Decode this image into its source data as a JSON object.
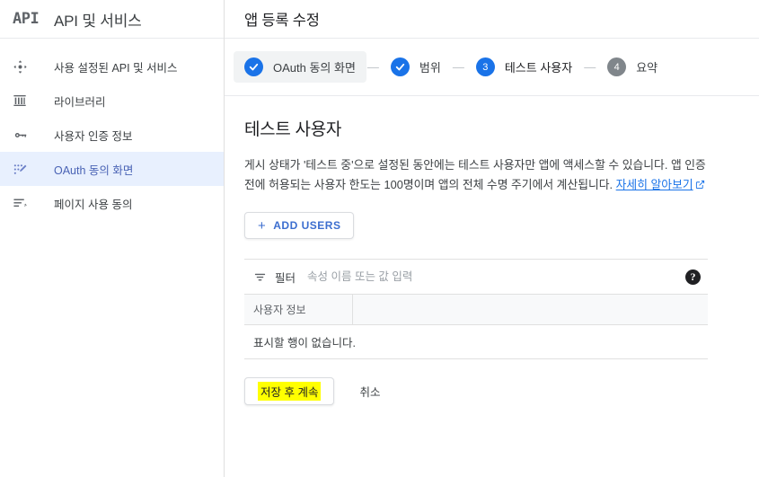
{
  "sidebar": {
    "logo_text": "API",
    "title": "API 및 서비스",
    "items": [
      {
        "label": "사용 설정된 API 및 서비스",
        "icon": "enabled-apis-icon",
        "active": false
      },
      {
        "label": "라이브러리",
        "icon": "library-icon",
        "active": false
      },
      {
        "label": "사용자 인증 정보",
        "icon": "key-icon",
        "active": false
      },
      {
        "label": "OAuth 동의 화면",
        "icon": "oauth-consent-icon",
        "active": true
      },
      {
        "label": "페이지 사용 동의",
        "icon": "page-usage-agreement-icon",
        "active": false
      }
    ]
  },
  "header": {
    "title": "앱 등록 수정"
  },
  "stepper": {
    "steps": [
      {
        "label": "OAuth 동의 화면",
        "badge": "check",
        "state": "done"
      },
      {
        "label": "범위",
        "badge": "check",
        "state": "done"
      },
      {
        "label": "테스트 사용자",
        "badge": "3",
        "state": "current"
      },
      {
        "label": "요약",
        "badge": "4",
        "state": "todo"
      }
    ],
    "separator": "—"
  },
  "content": {
    "section_title": "테스트 사용자",
    "description_part1": "게시 상태가 '테스트 중'으로 설정된 동안에는 테스트 사용자만 앱에 액세스할 수 있습니다. 앱 인증 전에 허용되는 사용자 한도는 100명이며 앱의 전체 수명 주기에서 계산됩니다. ",
    "learn_more_link": "자세히 알아보기",
    "add_users_button": "ADD USERS",
    "add_users_plus": "+"
  },
  "table": {
    "filter_label": "필터",
    "filter_value": "",
    "filter_placeholder": "속성 이름 또는 값 입력",
    "help_glyph": "?",
    "columns": [
      "사용자 정보",
      ""
    ],
    "rows": [],
    "empty_message": "표시할 행이 없습니다."
  },
  "actions": {
    "save_label": "저장 후 계속",
    "cancel_label": "취소",
    "highlight_color": "#ffff00"
  }
}
